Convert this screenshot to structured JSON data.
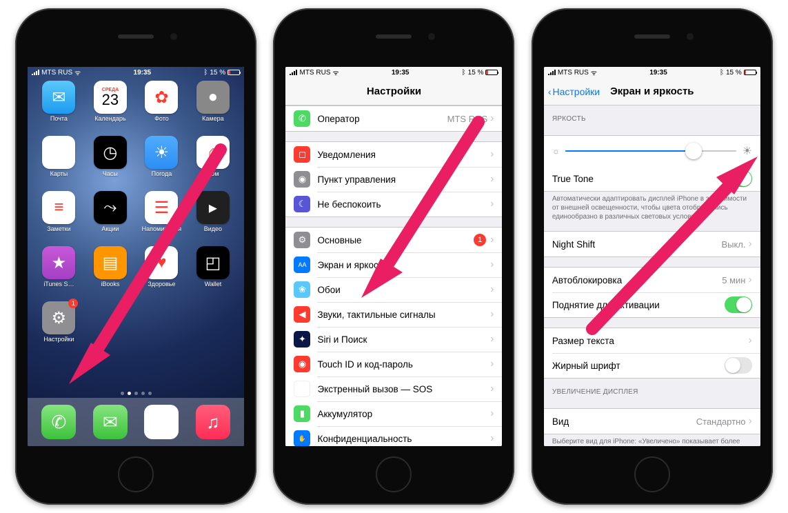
{
  "status": {
    "carrier": "MTS RUS",
    "time": "19:35",
    "battery": "15 %"
  },
  "phone1": {
    "apps": [
      {
        "label": "Почта",
        "icon": "✉",
        "cls": "c-mail"
      },
      {
        "label": "Календарь",
        "cal_dow": "СРЕДА",
        "cal_day": "23"
      },
      {
        "label": "Фото",
        "icon": "✿",
        "cls": "c-photo"
      },
      {
        "label": "Камера",
        "icon": "●",
        "cls": "c-cam"
      },
      {
        "label": "Карты",
        "icon": "➤",
        "cls": "c-maps"
      },
      {
        "label": "Часы",
        "icon": "◷",
        "cls": "c-clock"
      },
      {
        "label": "Погода",
        "icon": "☀",
        "cls": "c-weather"
      },
      {
        "label": "Дом",
        "icon": "⌂",
        "cls": "c-home"
      },
      {
        "label": "Заметки",
        "icon": "≡",
        "cls": "c-notes"
      },
      {
        "label": "Акции",
        "icon": "⤳",
        "cls": "c-stocks"
      },
      {
        "label": "Напоминания",
        "icon": "☰",
        "cls": "c-remind"
      },
      {
        "label": "Видео",
        "icon": "▸",
        "cls": "c-video"
      },
      {
        "label": "iTunes S…",
        "icon": "★",
        "cls": "c-itunes"
      },
      {
        "label": "iBooks",
        "icon": "▤",
        "cls": "c-ibooks"
      },
      {
        "label": "Здоровье",
        "icon": "♥",
        "cls": "c-health"
      },
      {
        "label": "Wallet",
        "icon": "◰",
        "cls": "c-wallet"
      },
      {
        "label": "Настройки",
        "icon": "⚙",
        "cls": "c-settings",
        "badge": "1"
      }
    ],
    "dock": [
      {
        "name": "phone",
        "icon": "✆",
        "cls": "c-phone"
      },
      {
        "name": "messages",
        "icon": "✉",
        "cls": "c-msg"
      },
      {
        "name": "safari",
        "icon": "◎",
        "cls": "c-safari"
      },
      {
        "name": "music",
        "icon": "♫",
        "cls": "c-music"
      }
    ]
  },
  "phone2": {
    "title": "Настройки",
    "rows": [
      {
        "icon": "✆",
        "cls": "c-green",
        "label": "Оператор",
        "value": "MTS RUS"
      },
      null,
      {
        "icon": "◻",
        "cls": "c-red",
        "label": "Уведомления"
      },
      {
        "icon": "◉",
        "cls": "c-grey",
        "label": "Пункт управления"
      },
      {
        "icon": "☾",
        "cls": "c-purple",
        "label": "Не беспокоить"
      },
      null,
      {
        "icon": "⚙",
        "cls": "c-gear",
        "label": "Основные",
        "badge": "1"
      },
      {
        "icon": "AA",
        "cls": "c-blue",
        "label": "Экран и яркость"
      },
      {
        "icon": "❀",
        "cls": "c-lblue",
        "label": "Обои"
      },
      {
        "icon": "◀",
        "cls": "c-red",
        "label": "Звуки, тактильные сигналы"
      },
      {
        "icon": "✦",
        "cls": "c-darkblue",
        "label": "Siri и Поиск"
      },
      {
        "icon": "◉",
        "cls": "c-red",
        "label": "Touch ID и код-пароль"
      },
      {
        "icon": "SOS",
        "cls": "c-sos",
        "label": "Экстренный вызов — SOS"
      },
      {
        "icon": "▮",
        "cls": "c-green",
        "label": "Аккумулятор"
      },
      {
        "icon": "✋",
        "cls": "c-blue",
        "label": "Конфиденциальность"
      }
    ]
  },
  "phone3": {
    "back": "Настройки",
    "title": "Экран и яркость",
    "section_brightness": "ЯРКОСТЬ",
    "brightness_pct": 75,
    "true_tone": {
      "label": "True Tone",
      "on": true
    },
    "true_tone_desc": "Автоматически адаптировать дисплей iPhone в зависимости от внешней освещенности, чтобы цвета отображались единообразно в различных световых условиях.",
    "night_shift": {
      "label": "Night Shift",
      "value": "Выкл."
    },
    "auto_lock": {
      "label": "Автоблокировка",
      "value": "5 мин"
    },
    "raise_wake": {
      "label": "Поднятие для активации",
      "on": true
    },
    "text_size": {
      "label": "Размер текста"
    },
    "bold_text": {
      "label": "Жирный шрифт",
      "on": false
    },
    "section_zoom": "УВЕЛИЧЕНИЕ ДИСПЛЕЯ",
    "view": {
      "label": "Вид",
      "value": "Стандартно"
    },
    "view_desc": "Выберите вид для iPhone: «Увеличено» показывает более"
  }
}
